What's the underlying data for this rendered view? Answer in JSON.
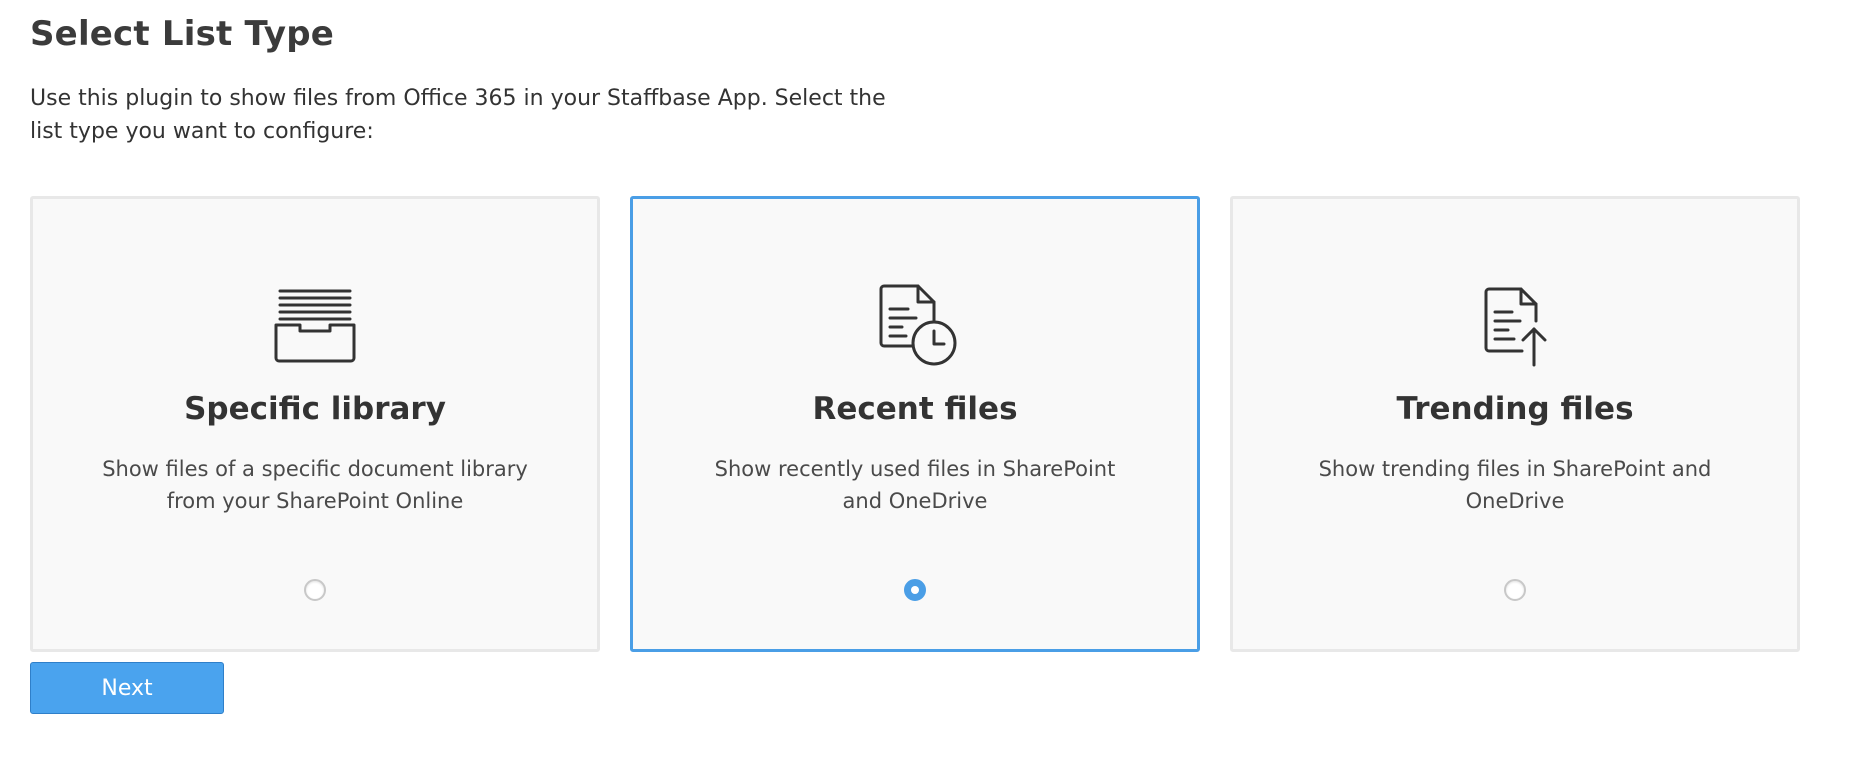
{
  "header": {
    "title": "Select List Type",
    "intro": "Use this plugin to show files from Office 365 in your Staffbase App. Select the list type you want to configure:"
  },
  "options": [
    {
      "title": "Specific library",
      "description": "Show files of a specific document library from your SharePoint Online",
      "icon": "inbox-tray-icon",
      "selected": false
    },
    {
      "title": "Recent files",
      "description": "Show recently used files in SharePoint and OneDrive",
      "icon": "document-clock-icon",
      "selected": true
    },
    {
      "title": "Trending files",
      "description": "Show trending files in SharePoint and OneDrive",
      "icon": "document-arrow-up-icon",
      "selected": false
    }
  ],
  "footer": {
    "next_label": "Next"
  },
  "colors": {
    "accent": "#4a9ee6",
    "button": "#4aa3ee",
    "card_background": "#f9f9f9",
    "card_border": "#e8e8e8"
  }
}
